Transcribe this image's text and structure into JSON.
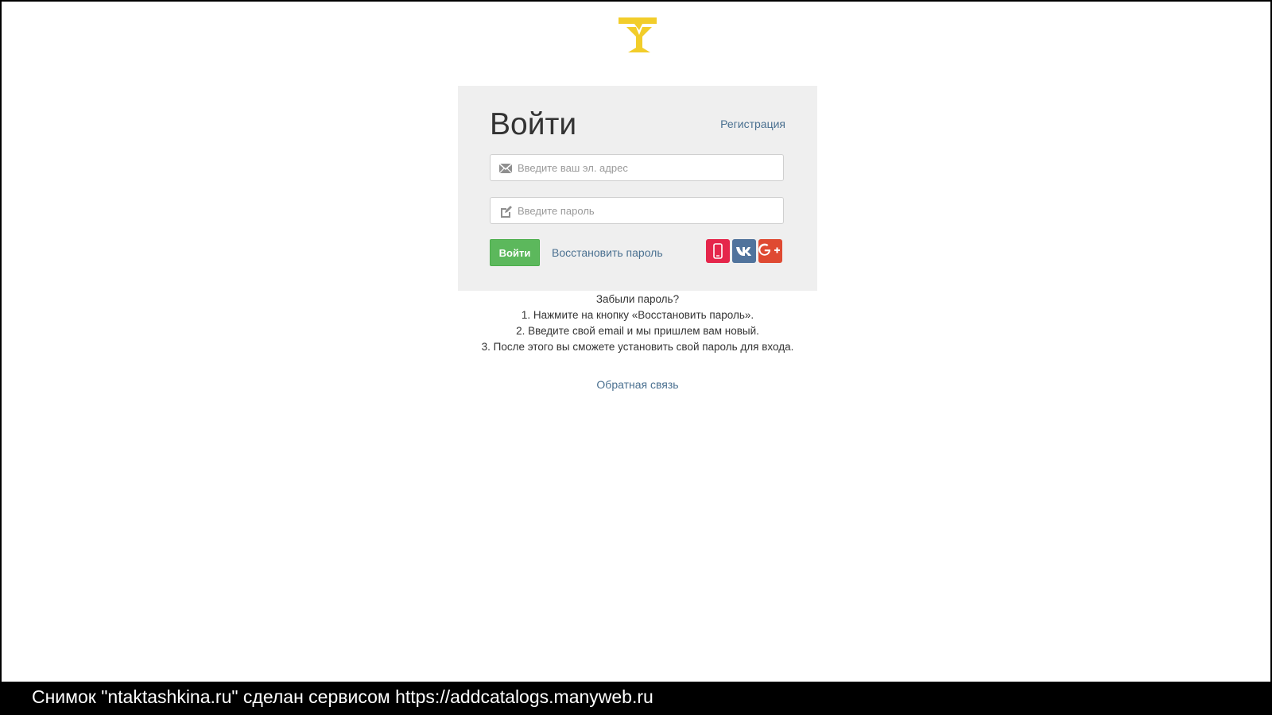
{
  "login": {
    "title": "Войти",
    "register_link": "Регистрация",
    "email_placeholder": "Введите ваш эл. адрес",
    "password_placeholder": "Введите пароль",
    "submit_label": "Войти",
    "restore_link": "Восстановить пароль",
    "social": [
      {
        "name": "phone-icon",
        "color": "#e5264b"
      },
      {
        "name": "vk-icon",
        "color": "#50739c"
      },
      {
        "name": "google-plus-icon",
        "color": "#df4a32"
      }
    ]
  },
  "help": {
    "title": "Забыли пароль?",
    "steps": [
      "1. Нажмите на кнопку «Восстановить пароль».",
      "2. Введите свой email и мы пришлем вам новый.",
      "3. После этого вы сможете установить свой пароль для входа."
    ]
  },
  "footer": {
    "feedback_link": "Обратная связь"
  },
  "caption": {
    "text": "Снимок \"ntaktashkina.ru\" сделан сервисом https://addcatalogs.manyweb.ru"
  },
  "colors": {
    "logo": "#f2cd2a",
    "primary_button": "#5cb85c",
    "link": "#4a7090",
    "card_background": "#efefef"
  }
}
